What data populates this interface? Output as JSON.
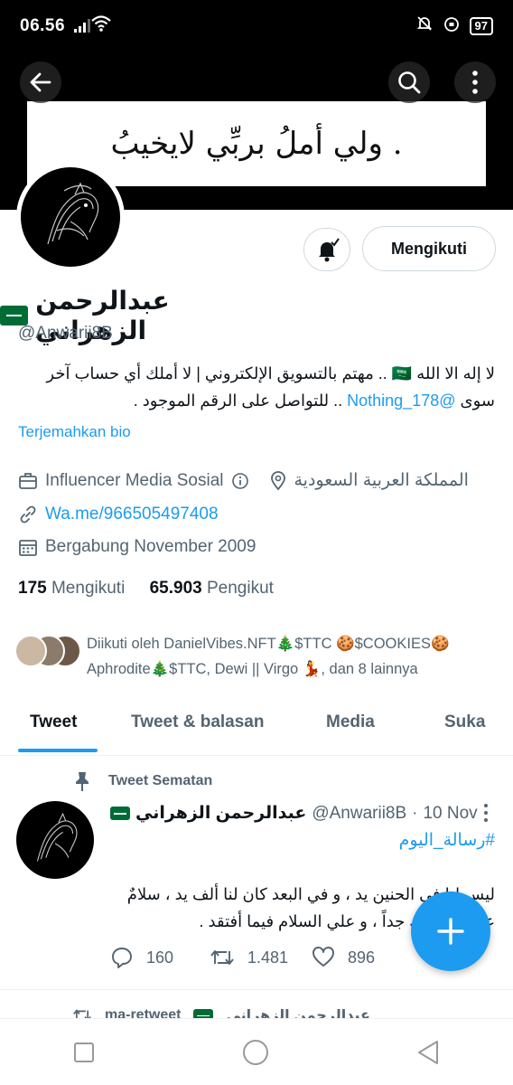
{
  "status_bar": {
    "time": "06.56",
    "battery": "97"
  },
  "banner": {
    "text": "ولي أملُ بربِّي لايخيبُ ."
  },
  "profile": {
    "name": "عبدالرحمن الزهراني",
    "handle": "@Anwarii8B",
    "bell_label": "notification-bell",
    "follow_button": "Mengikuti",
    "bio_line1": "لا إله الا الله 🇸🇦 .. مهتم بالتسويق الإلكتروني | لا أملك أي حساب آخر",
    "bio_line2_prefix": "سوى ",
    "bio_mention": "@Nothing_178",
    "bio_line2_suffix": " .. للتواصل على الرقم الموجود .",
    "translate_bio": "Terjemahkan bio",
    "category": "Influencer Media Sosial",
    "location": "المملكة العربية السعودية",
    "link": "Wa.me/966505497408",
    "joined": "Bergabung November 2009",
    "following_count": "175",
    "following_label": "Mengikuti",
    "followers_count": "65.903",
    "followers_label": "Pengikut",
    "followed_by_line1": "Diikuti oleh DanielVibes.NFT🎄$TTC 🍪$COOKIES🍪",
    "followed_by_line2": "Aphrodite🎄$TTC, Dewi || Virgo 💃, dan 8 lainnya"
  },
  "tabs": [
    {
      "label": "Tweet",
      "active": true
    },
    {
      "label": "Tweet & balasan",
      "active": false
    },
    {
      "label": "Media",
      "active": false
    },
    {
      "label": "Suka",
      "active": false
    }
  ],
  "pinned_tweet": {
    "pinned_label": "Tweet Sematan",
    "author_name": "عبدالرحمن الزهراني",
    "author_handle": "@Anwarii8B",
    "separator": "·",
    "date": "10 Nov",
    "hashtag": "#رسالة_اليوم",
    "text_line1": "ليس لنا في الحنين يد ، و في البعد كان لنا ألف يد ، سلامٌ",
    "text_line2": "عليك أفتقدك جداً ، و علي السلام فيما أفتقد .",
    "replies": "160",
    "retweets": "1.481",
    "likes": "896"
  },
  "next_tweet_peek": {
    "label": "ma-retweet",
    "name": "عبدالرحمن الزهراني"
  },
  "colors": {
    "accent": "#1d9bf0",
    "muted": "#536471",
    "text": "#0f1419"
  }
}
